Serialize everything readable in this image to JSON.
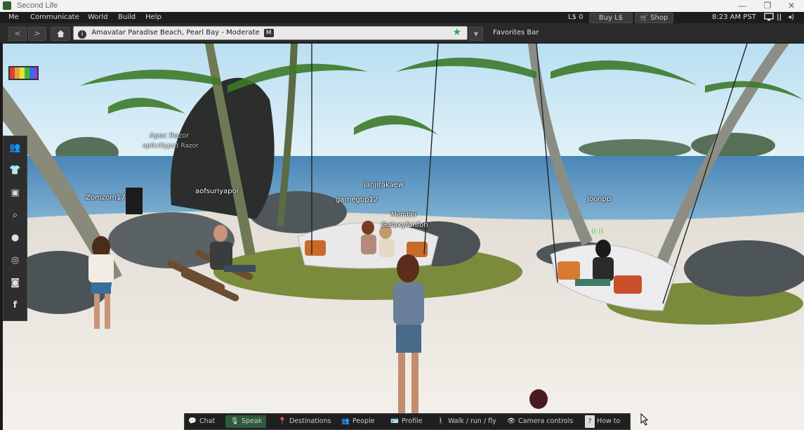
{
  "window": {
    "title": "Second Life",
    "controls": {
      "minimize": "—",
      "restore": "❐",
      "close": "✕"
    }
  },
  "menu": {
    "items": [
      "Me",
      "Communicate",
      "World",
      "Build",
      "Help"
    ],
    "balance": "L$ 0",
    "buy_label": "Buy L$",
    "shop_label": "Shop",
    "time": "8:23 AM PST"
  },
  "navbar": {
    "location": "Amavatar Paradise Beach, Pearl Bay - Moderate",
    "maturity_badge": "M",
    "favorites_label": "Favorites Bar"
  },
  "scene": {
    "avatar_tags": [
      {
        "name": "Apoc Razor",
        "sub": "ap0c4lyps3 Razor"
      },
      {
        "name": "aofsuriyapol"
      },
      {
        "name": "Zomzom17"
      },
      {
        "name": "janjirakaew"
      },
      {
        "name": "gamegbp12"
      },
      {
        "name": "Member"
      },
      {
        "name": "Galaxyfonfon"
      },
      {
        "name": "Joonpp"
      }
    ]
  },
  "bottombar": {
    "buttons": [
      {
        "label": "Chat",
        "icon": "chat-bubble-icon"
      },
      {
        "label": "Speak",
        "icon": "microphone-icon"
      },
      {
        "label": "Destinations",
        "icon": "map-pin-icon"
      },
      {
        "label": "People",
        "icon": "people-icon"
      },
      {
        "label": "Profile",
        "icon": "profile-card-icon"
      },
      {
        "label": "Walk / run / fly",
        "icon": "walking-person-icon"
      },
      {
        "label": "Camera controls",
        "icon": "eye-icon"
      },
      {
        "label": "How to",
        "icon": "question-icon"
      }
    ]
  },
  "colors": {
    "speak_active": "#2d5a3c",
    "favorite_star": "#2aa84a"
  }
}
